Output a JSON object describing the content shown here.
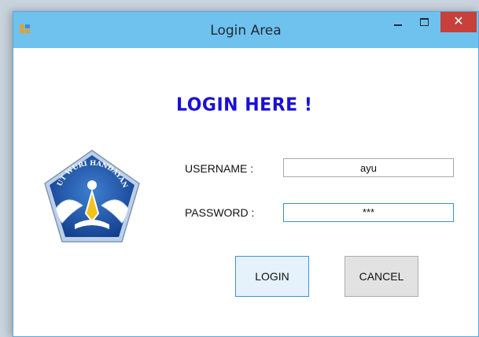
{
  "window": {
    "title": "Login Area",
    "icon": "windows-form-icon",
    "controls": {
      "minimize": "minimize-icon",
      "maximize": "maximize-icon",
      "close": "close-icon"
    }
  },
  "form": {
    "heading": "LOGIN HERE !",
    "logo": {
      "icon": "tut-wuri-handayani-emblem",
      "text": "TUT WURI HANDAYANI"
    },
    "username": {
      "label": "USERNAME :",
      "value": "ayu"
    },
    "password": {
      "label": "PASSWORD :",
      "masked_value": "***"
    },
    "buttons": {
      "login": "LOGIN",
      "cancel": "CANCEL"
    }
  },
  "colors": {
    "titlebar": "#6fc1ee",
    "close_button": "#c7403a",
    "heading": "#1a10d6",
    "logo_blue": "#1e56a8",
    "focus_border": "#3d8fd6"
  }
}
